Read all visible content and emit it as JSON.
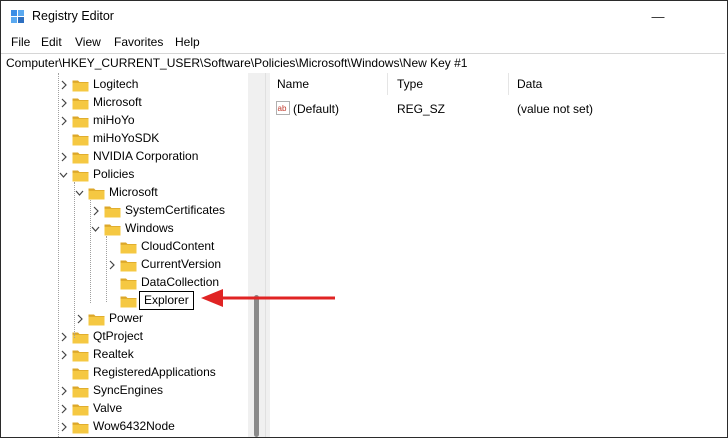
{
  "window": {
    "title": "Registry Editor",
    "controls": {
      "minimize": "—",
      "maximize": "☐",
      "close": "✕"
    }
  },
  "menu": [
    "File",
    "Edit",
    "View",
    "Favorites",
    "Help"
  ],
  "address": "Computer\\HKEY_CURRENT_USER\\Software\\Policies\\Microsoft\\Windows\\New Key #1",
  "tree": [
    {
      "label": "Logitech",
      "level": 0,
      "expander": "right"
    },
    {
      "label": "Microsoft",
      "level": 0,
      "expander": "right"
    },
    {
      "label": "miHoYo",
      "level": 0,
      "expander": "right"
    },
    {
      "label": "miHoYoSDK",
      "level": 0,
      "expander": "none"
    },
    {
      "label": "NVIDIA Corporation",
      "level": 0,
      "expander": "right"
    },
    {
      "label": "Policies",
      "level": 0,
      "expander": "down"
    },
    {
      "label": "Microsoft",
      "level": 1,
      "expander": "down"
    },
    {
      "label": "SystemCertificates",
      "level": 2,
      "expander": "right"
    },
    {
      "label": "Windows",
      "level": 2,
      "expander": "down"
    },
    {
      "label": "CloudContent",
      "level": 3,
      "expander": "none"
    },
    {
      "label": "CurrentVersion",
      "level": 3,
      "expander": "right"
    },
    {
      "label": "DataCollection",
      "level": 3,
      "expander": "none"
    },
    {
      "label": "Explorer",
      "level": 3,
      "expander": "none",
      "editing": true
    },
    {
      "label": "Power",
      "level": 1,
      "expander": "right"
    },
    {
      "label": "QtProject",
      "level": 0,
      "expander": "right"
    },
    {
      "label": "Realtek",
      "level": 0,
      "expander": "right"
    },
    {
      "label": "RegisteredApplications",
      "level": 0,
      "expander": "none"
    },
    {
      "label": "SyncEngines",
      "level": 0,
      "expander": "right"
    },
    {
      "label": "Valve",
      "level": 0,
      "expander": "right"
    },
    {
      "label": "Wow6432Node",
      "level": 0,
      "expander": "right"
    }
  ],
  "list": {
    "columns": [
      "Name",
      "Type",
      "Data"
    ],
    "rows": [
      {
        "icon": "string-value-icon",
        "name": "(Default)",
        "type": "REG_SZ",
        "data": "(value not set)"
      }
    ]
  },
  "colors": {
    "folder": "#f5c842",
    "folder_dark": "#dca72a",
    "annotation_arrow": "#e02424"
  }
}
